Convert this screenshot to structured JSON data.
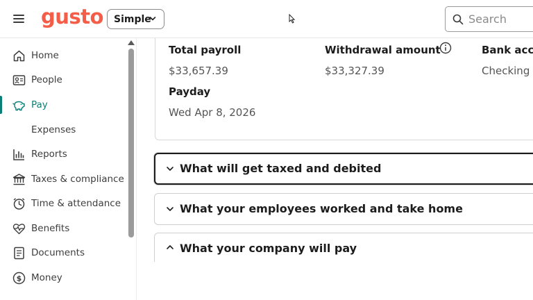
{
  "header": {
    "logo": "gusto",
    "mode_select": "Simple",
    "search_placeholder": "Search",
    "icons": [
      "menu-icon",
      "chevron-down-icon",
      "search-icon"
    ]
  },
  "sidebar": {
    "items": [
      {
        "label": "Home",
        "icon": "home-icon"
      },
      {
        "label": "People",
        "icon": "people-icon"
      },
      {
        "label": "Pay",
        "icon": "piggy-bank-icon",
        "active": true
      },
      {
        "label": "Expenses",
        "icon": ""
      },
      {
        "label": "Reports",
        "icon": "bar-chart-icon"
      },
      {
        "label": "Taxes & compliance",
        "icon": "bank-icon"
      },
      {
        "label": "Time & attendance",
        "icon": "clock-icon"
      },
      {
        "label": "Benefits",
        "icon": "heart-pulse-icon"
      },
      {
        "label": "Documents",
        "icon": "document-icon"
      },
      {
        "label": "Money",
        "icon": "dollar-circle-icon"
      }
    ]
  },
  "summary": {
    "total_payroll_label": "Total payroll",
    "total_payroll_value": "$33,657.39",
    "withdrawal_label": "Withdrawal amount",
    "withdrawal_value": "$33,327.39",
    "bank_label": "Bank acco",
    "bank_value": "Checking",
    "payday_label": "Payday",
    "payday_value": "Wed Apr 8, 2026"
  },
  "accordions": [
    {
      "title": "What will get taxed and debited",
      "expanded": false,
      "focused": true
    },
    {
      "title": "What your employees worked and take home",
      "expanded": false
    },
    {
      "title": "What your company will pay",
      "expanded": true
    }
  ],
  "colors": {
    "brand": "#f45d48",
    "accent": "#0a7f78",
    "text": "#1c1c1c",
    "muted": "#555555"
  }
}
